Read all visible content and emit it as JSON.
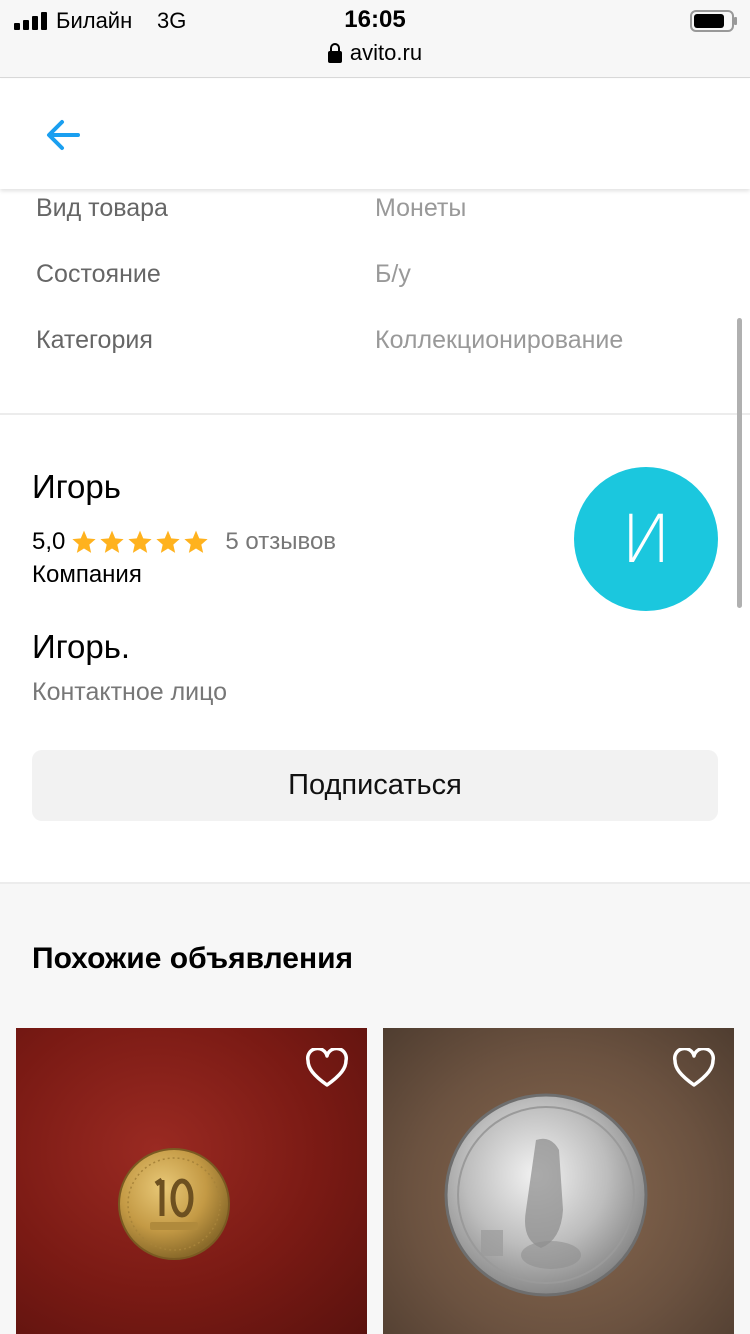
{
  "status": {
    "carrier": "Билайн",
    "network": "3G",
    "time": "16:05",
    "url": "avito.ru"
  },
  "params": [
    {
      "label": "Вид товара",
      "value": "Монеты"
    },
    {
      "label": "Состояние",
      "value": "Б/у"
    },
    {
      "label": "Категория",
      "value": "Коллекционирование"
    }
  ],
  "seller": {
    "name": "Игорь",
    "rating": "5,0",
    "stars": 5,
    "reviews": "5 отзывов",
    "type": "Компания",
    "avatar_letter": "И",
    "avatar_color": "#1bc7de",
    "contact_name": "Игорь.",
    "contact_role": "Контактное лицо",
    "subscribe_label": "Подписаться"
  },
  "similar": {
    "title": "Похожие объявления",
    "items": [
      {
        "image": "coin-10-kopeks-photo"
      },
      {
        "image": "coin-krokodil-gena-photo"
      }
    ]
  },
  "colors": {
    "accent": "#1a9ff0",
    "star": "#ffb21e"
  }
}
